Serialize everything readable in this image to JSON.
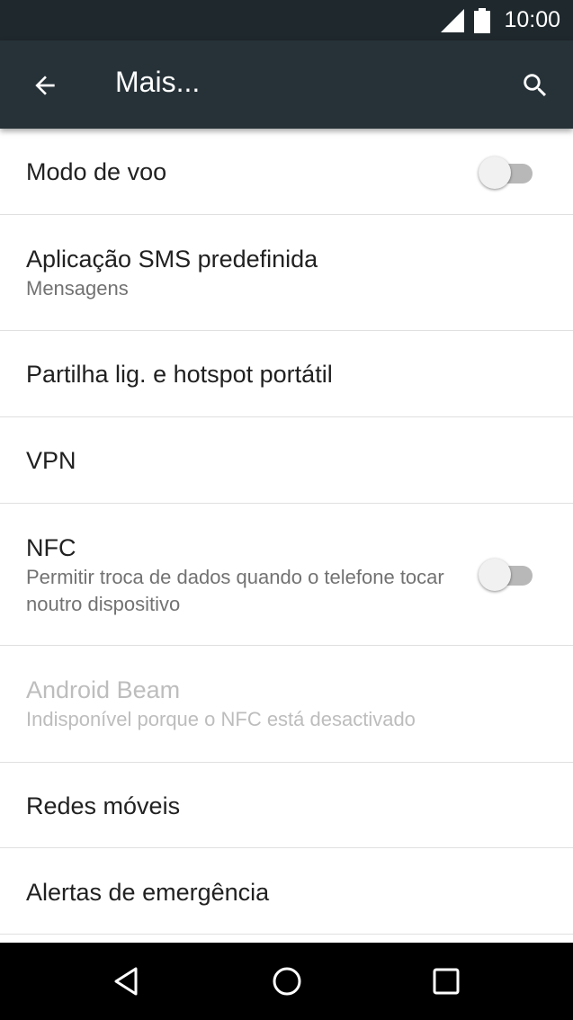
{
  "status_bar": {
    "time": "10:00",
    "icons": [
      "signal-icon",
      "battery-icon"
    ]
  },
  "app_bar": {
    "title": "Mais...",
    "back_icon": "arrow-back-icon",
    "search_icon": "search-icon"
  },
  "settings": {
    "items": [
      {
        "label": "Modo de voo",
        "summary": "",
        "toggle": "off",
        "enabled": true
      },
      {
        "label": "Aplicação SMS predefinida",
        "summary": "Mensagens",
        "enabled": true
      },
      {
        "label": "Partilha lig. e hotspot portátil",
        "summary": "",
        "enabled": true
      },
      {
        "label": "VPN",
        "summary": "",
        "enabled": true
      },
      {
        "label": "NFC",
        "summary": "Permitir troca de dados quando o telefone tocar noutro dispositivo",
        "toggle": "off",
        "enabled": true
      },
      {
        "label": "Android Beam",
        "summary": "Indisponível porque o NFC está desactivado",
        "enabled": false
      },
      {
        "label": "Redes móveis",
        "summary": "",
        "enabled": true
      },
      {
        "label": "Alertas de emergência",
        "summary": "",
        "enabled": true
      }
    ]
  },
  "nav_bar": {
    "icons": [
      "back-triangle-icon",
      "home-circle-icon",
      "recents-square-icon"
    ]
  },
  "colors": {
    "status_bar": "#1f282d",
    "app_bar": "#263238",
    "divider": "#e0e0e0",
    "primary_text": "#212121",
    "secondary_text": "#727272",
    "disabled_text": "#bdbdbd"
  }
}
